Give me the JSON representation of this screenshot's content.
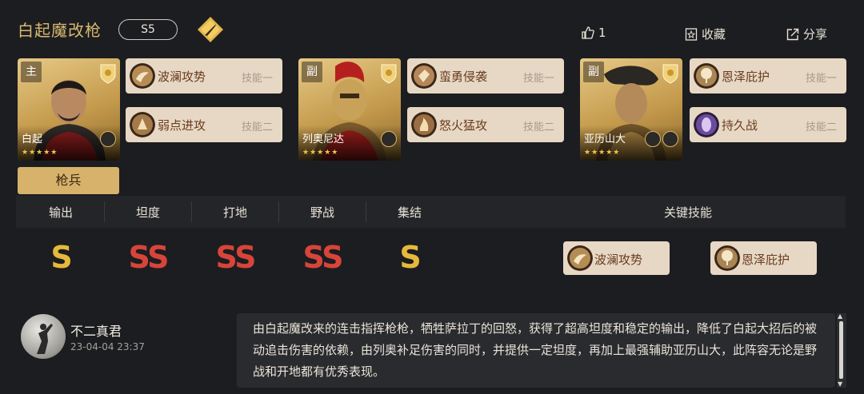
{
  "header": {
    "title": "白起魔改枪",
    "season": "S5",
    "like_count": "1",
    "favorite_label": "收藏",
    "share_label": "分享"
  },
  "colors": {
    "gold": "#d7b26a",
    "skill_card": "#e7d8c5",
    "grade_s": "#e6b93c",
    "grade_ss": "#d8443a",
    "background": "#1c1d20"
  },
  "heroes": [
    {
      "role": "主",
      "name": "白起",
      "skills": [
        {
          "name": "波澜攻势",
          "label": "技能一",
          "icon": "wave-attack-icon"
        },
        {
          "name": "弱点进攻",
          "label": "技能二",
          "icon": "weakpoint-icon"
        }
      ]
    },
    {
      "role": "副",
      "name": "列奥尼达",
      "skills": [
        {
          "name": "蛮勇侵袭",
          "label": "技能一",
          "icon": "brave-raid-icon"
        },
        {
          "name": "怒火猛攻",
          "label": "技能二",
          "icon": "fury-icon"
        }
      ]
    },
    {
      "role": "副",
      "name": "亚历山大",
      "skills": [
        {
          "name": "恩泽庇护",
          "label": "技能一",
          "icon": "tree-blessing-icon"
        },
        {
          "name": "持久战",
          "label": "技能二",
          "icon": "endurance-icon"
        }
      ]
    }
  ],
  "troop_class": "枪兵",
  "ratings": [
    {
      "label": "输出",
      "grade": "S"
    },
    {
      "label": "坦度",
      "grade": "SS"
    },
    {
      "label": "打地",
      "grade": "SS"
    },
    {
      "label": "野战",
      "grade": "SS"
    },
    {
      "label": "集结",
      "grade": "S"
    }
  ],
  "key_skills": {
    "label": "关键技能",
    "items": [
      {
        "name": "波澜攻势",
        "icon": "wave-attack-icon"
      },
      {
        "name": "恩泽庇护",
        "icon": "tree-blessing-icon"
      }
    ]
  },
  "comment": {
    "author": "不二真君",
    "date": "23-04-04 23:37",
    "text": "由白起魔改来的连击指挥枪枪，牺牲萨拉丁的回怒，获得了超高坦度和稳定的输出，降低了白起大招后的被动追击伤害的依赖，由列奥补足伤害的同时，并提供一定坦度，再加上最强辅助亚历山大，此阵容无论是野战和开地都有优秀表现。"
  }
}
